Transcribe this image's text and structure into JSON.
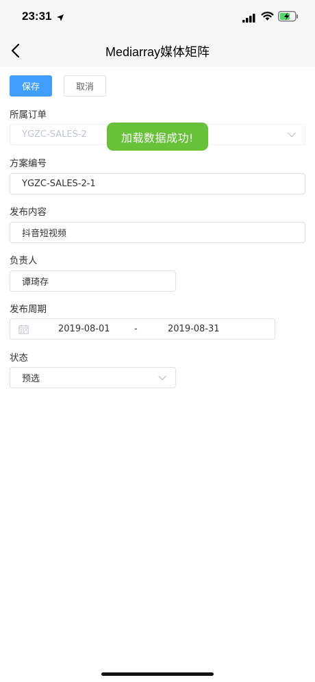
{
  "status_bar": {
    "time": "23:31",
    "icons": [
      "location-arrow-icon",
      "signal-icon",
      "wifi-icon",
      "battery-charging-icon"
    ]
  },
  "nav": {
    "title": "Mediarray媒体矩阵",
    "back_icon": "chevron-left-icon"
  },
  "toolbar": {
    "save_label": "保存",
    "cancel_label": "取消"
  },
  "form": {
    "order": {
      "label": "所属订单",
      "value": "YGZC-SALES-2"
    },
    "plan_no": {
      "label": "方案编号",
      "value": "YGZC-SALES-2-1"
    },
    "content": {
      "label": "发布内容",
      "value": "抖音短视频"
    },
    "owner": {
      "label": "负责人",
      "value": "谭琦存"
    },
    "period": {
      "label": "发布周期",
      "start": "2019-08-01",
      "separator": "-",
      "end": "2019-08-31"
    },
    "status": {
      "label": "状态",
      "value": "预选"
    }
  },
  "toast": {
    "message": "加载数据成功!"
  },
  "colors": {
    "primary": "#409eff",
    "success_toast": "#67c23a",
    "border": "#dcdfe6",
    "text": "#303133",
    "placeholder": "#c0c4cc"
  }
}
